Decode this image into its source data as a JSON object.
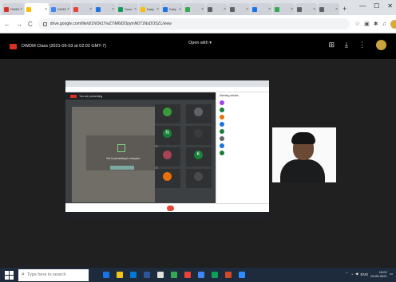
{
  "browser": {
    "tabs": [
      {
        "label": "DWDM",
        "favicon_color": "#d93025"
      },
      {
        "label": "",
        "favicon_color": "#fbbc04",
        "active": true
      },
      {
        "label": "DWDM",
        "favicon_color": "#4285f4"
      },
      {
        "label": "",
        "favicon_color": "#ea4335"
      },
      {
        "label": "",
        "favicon_color": "#1a73e8"
      },
      {
        "label": "Drive",
        "favicon_color": "#0f9d58"
      },
      {
        "label": "Daily",
        "favicon_color": "#fbbc04"
      },
      {
        "label": "Daily",
        "favicon_color": "#1a73e8"
      },
      {
        "label": "",
        "favicon_color": "#34a853"
      },
      {
        "label": "",
        "favicon_color": "#5f6368"
      },
      {
        "label": "",
        "favicon_color": "#5f6368"
      },
      {
        "label": "",
        "favicon_color": "#1a73e8"
      },
      {
        "label": "",
        "favicon_color": "#34a853"
      },
      {
        "label": "",
        "favicon_color": "#5f6368"
      },
      {
        "label": "",
        "favicon_color": "#5f6368"
      }
    ],
    "new_tab_glyph": "+",
    "url": "drive.google.com/file/d/1NOk1YwZ7iM6iDOpymN071NsDOSZL/view",
    "nav": {
      "back": "←",
      "forward": "→",
      "reload": "C"
    },
    "window_controls": {
      "minimize": "—",
      "maximize": "☐",
      "close": "✕"
    }
  },
  "drive": {
    "file_title": "DWDM Class (2021-05-03 at 02:02 GMT-7)",
    "open_with_label": "Open with ▾"
  },
  "recording": {
    "presenting_text": "You are presenting",
    "present_center_text": "You're presenting to everyone",
    "participants": [
      {
        "initial": "",
        "color": "#3a9a3c",
        "name": ""
      },
      {
        "initial": "",
        "color": "#5f6368",
        "name": ""
      },
      {
        "initial": "N",
        "color": "#188038",
        "name": ""
      },
      {
        "initial": "",
        "color": "#3b3b3b",
        "name": ""
      },
      {
        "initial": "",
        "color": "#aa4455",
        "name": ""
      },
      {
        "initial": "K",
        "color": "#188038",
        "name": ""
      },
      {
        "initial": "",
        "color": "#e8710a",
        "name": ""
      },
      {
        "initial": "",
        "color": "#4a4a4a",
        "name": ""
      }
    ],
    "side_title": "Meeting details"
  },
  "taskbar": {
    "search_placeholder": "Type here to search",
    "time": "15:02",
    "date": "03-05-2021",
    "language": "ENG"
  }
}
